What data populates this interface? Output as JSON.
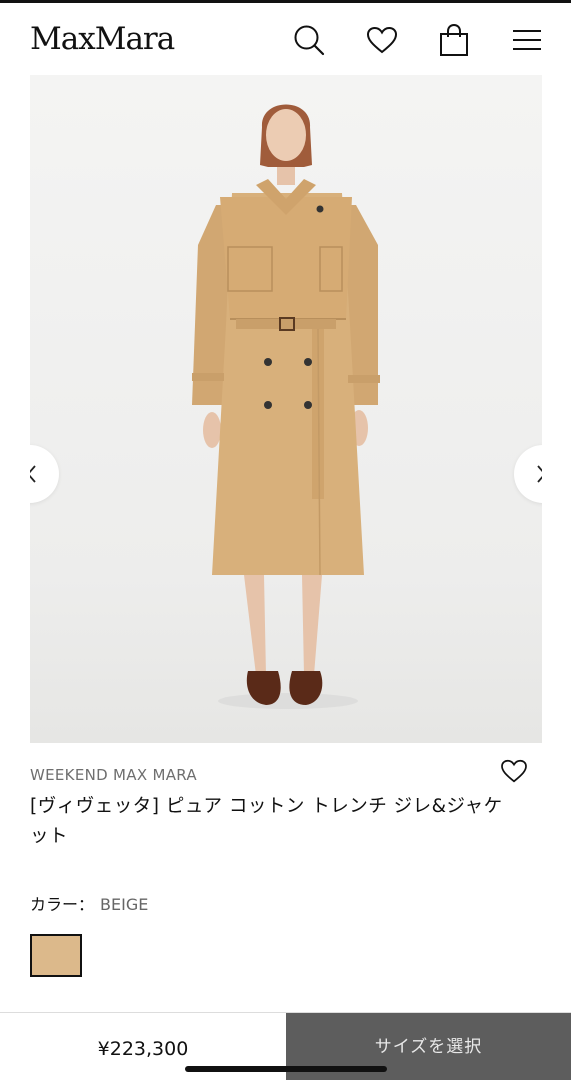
{
  "header": {
    "logo": "MaxMara",
    "icons": [
      "search-icon",
      "heart-icon",
      "shopping-bag-icon",
      "menu-icon"
    ]
  },
  "gallery": {
    "image": "product-photo",
    "prev_icon": "chevron-left-icon",
    "next_icon": "chevron-right-icon"
  },
  "product": {
    "brand": "WEEKEND MAX MARA",
    "title": "[ヴィヴェッタ] ピュア コットン トレンチ ジレ&ジャケット",
    "color_label": "カラー：",
    "color_value": "BEIGE",
    "swatch_color": "#dcb98b"
  },
  "purchase": {
    "price": "¥223,300",
    "select_size": "サイズを選択"
  }
}
